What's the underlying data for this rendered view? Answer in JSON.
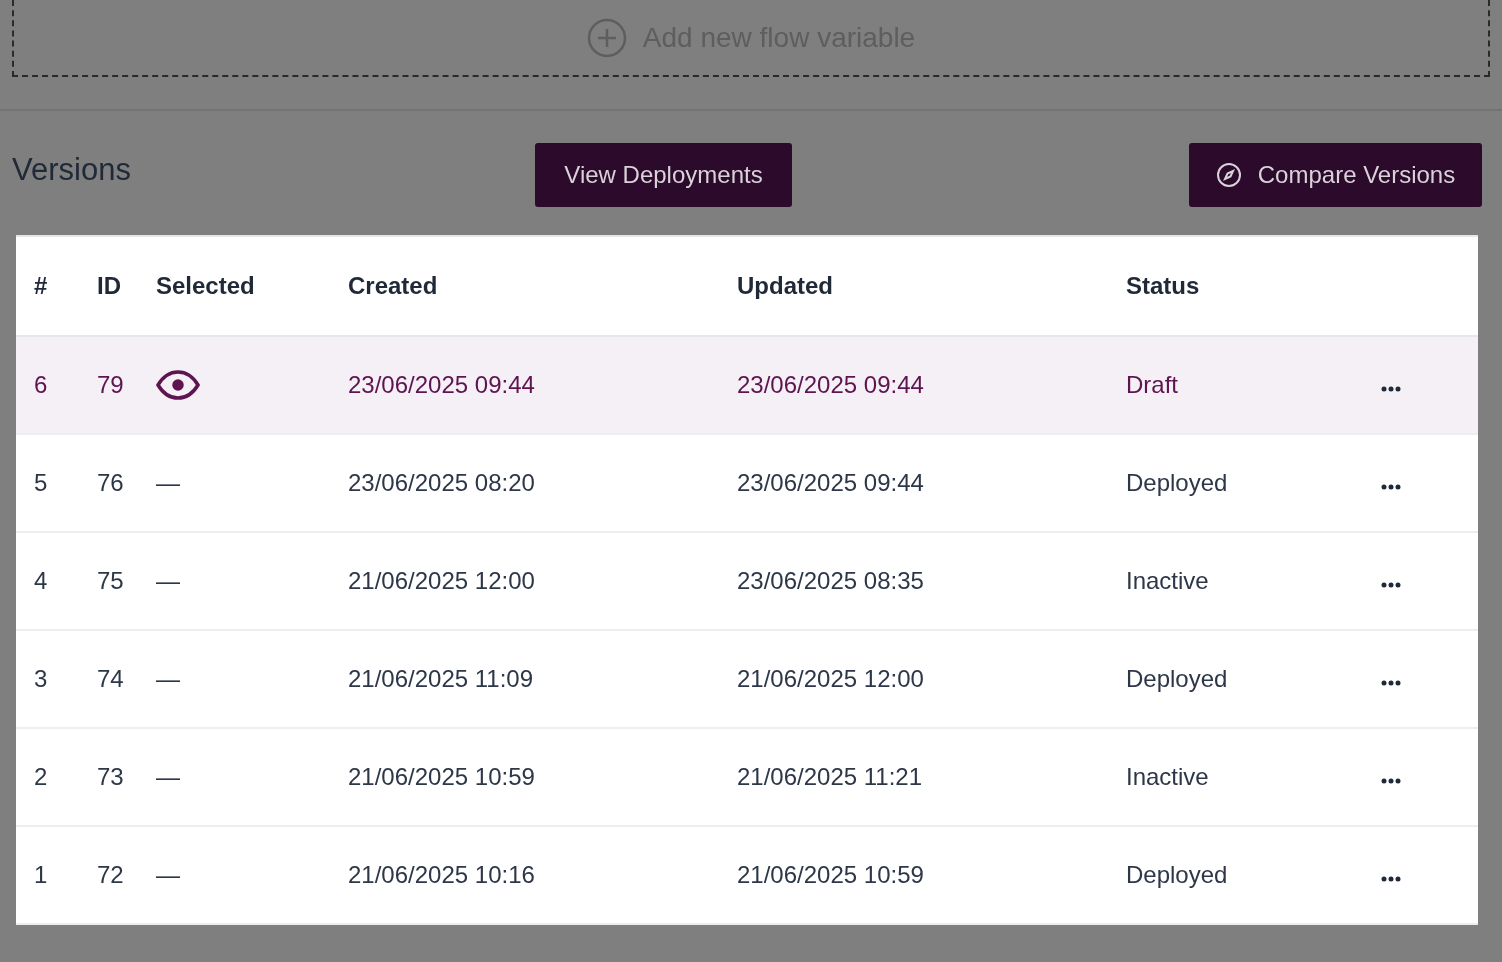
{
  "add_variable": {
    "label": "Add new flow variable"
  },
  "versions": {
    "title": "Versions",
    "view_button": "View Deployments",
    "compare_button": "Compare Versions"
  },
  "table": {
    "columns": [
      "#",
      "ID",
      "Selected",
      "Created",
      "Updated",
      "Status"
    ],
    "rows": [
      {
        "num": "6",
        "id": "79",
        "selected": true,
        "created": "23/06/2025 09:44",
        "updated": "23/06/2025 09:44",
        "status": "Draft"
      },
      {
        "num": "5",
        "id": "76",
        "selected": false,
        "selected_text": "—",
        "created": "23/06/2025 08:20",
        "updated": "23/06/2025 09:44",
        "status": "Deployed"
      },
      {
        "num": "4",
        "id": "75",
        "selected": false,
        "selected_text": "—",
        "created": "21/06/2025 12:00",
        "updated": "23/06/2025 08:35",
        "status": "Inactive"
      },
      {
        "num": "3",
        "id": "74",
        "selected": false,
        "selected_text": "—",
        "created": "21/06/2025 11:09",
        "updated": "21/06/2025 12:00",
        "status": "Deployed"
      },
      {
        "num": "2",
        "id": "73",
        "selected": false,
        "selected_text": "—",
        "created": "21/06/2025 10:59",
        "updated": "21/06/2025 11:21",
        "status": "Inactive"
      },
      {
        "num": "1",
        "id": "72",
        "selected": false,
        "selected_text": "—",
        "created": "21/06/2025 10:16",
        "updated": "21/06/2025 10:59",
        "status": "Deployed"
      }
    ]
  }
}
